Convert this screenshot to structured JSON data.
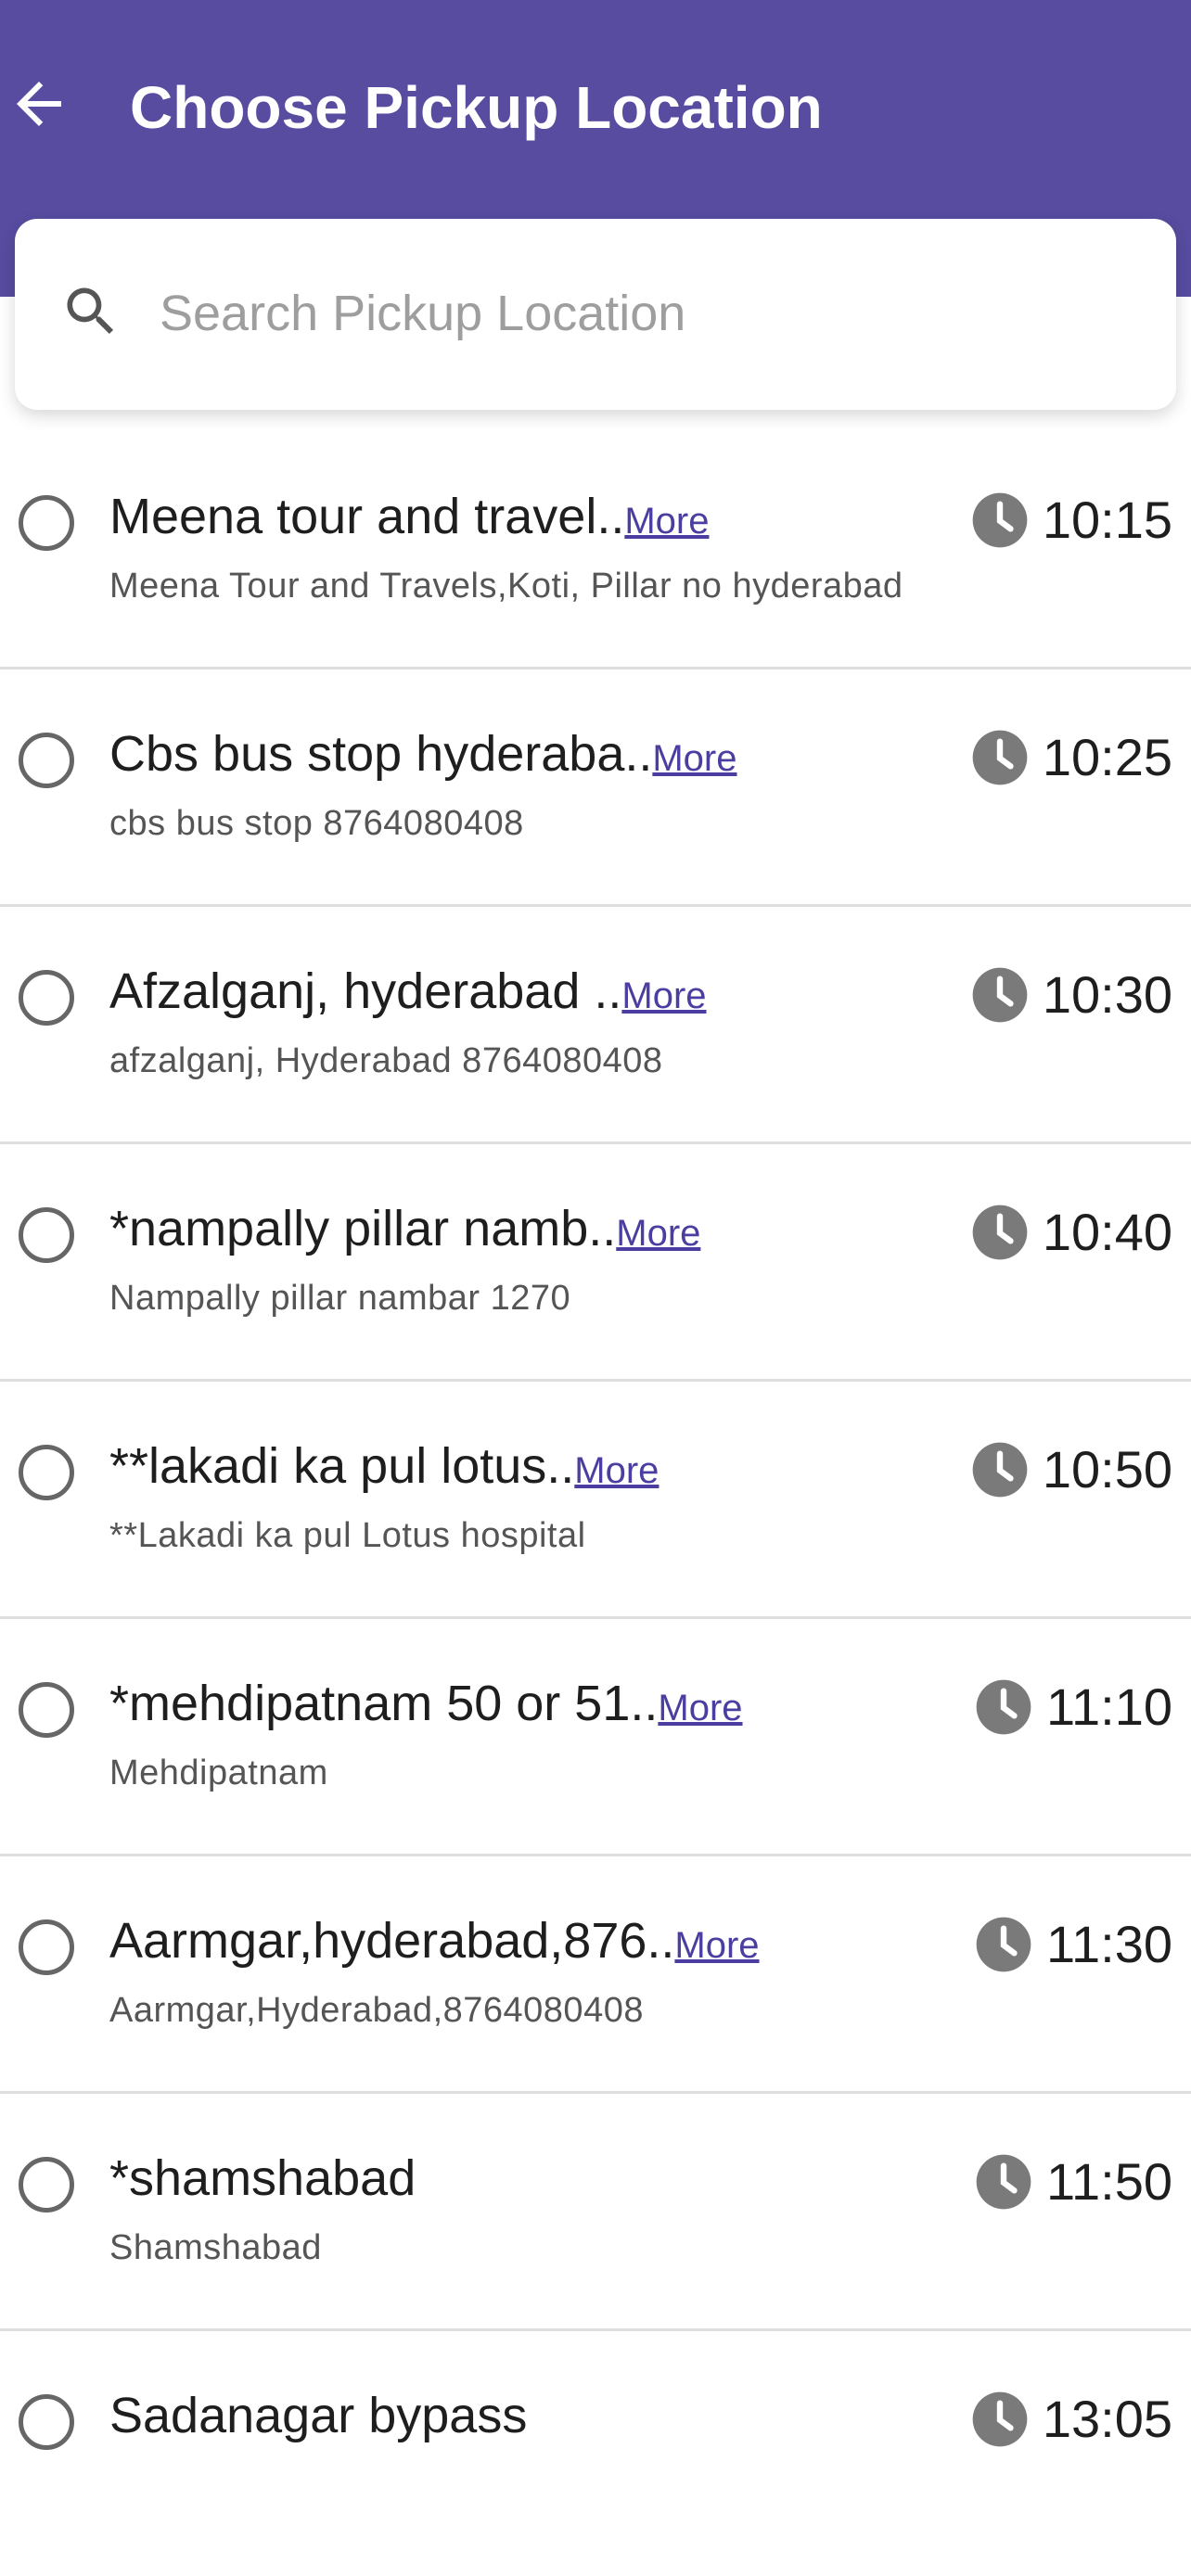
{
  "colors": {
    "header_bg": "#574ca0",
    "more_link": "#4a3fa0",
    "clock_icon": "#7a7a7a"
  },
  "header": {
    "title": "Choose Pickup Location",
    "back_icon": "arrow-left-icon"
  },
  "search": {
    "placeholder": "Search Pickup Location",
    "icon": "search-icon",
    "value": ""
  },
  "locations": [
    {
      "name": "Meena tour and travel..",
      "more": "More",
      "address": "Meena Tour and Travels,Koti, Pillar no hyderabad",
      "time": "10:15",
      "selected": false
    },
    {
      "name": "Cbs bus stop hyderaba..",
      "more": "More",
      "address": "cbs bus stop 8764080408",
      "time": "10:25",
      "selected": false
    },
    {
      "name": "Afzalganj, hyderabad ..",
      "more": "More",
      "address": "afzalganj, Hyderabad 8764080408",
      "time": "10:30",
      "selected": false
    },
    {
      "name": "*nampally pillar namb..",
      "more": "More",
      "address": "Nampally pillar nambar 1270",
      "time": "10:40",
      "selected": false
    },
    {
      "name": "**lakadi ka pul lotus..",
      "more": "More",
      "address": "**Lakadi ka pul Lotus hospital",
      "time": "10:50",
      "selected": false
    },
    {
      "name": "*mehdipatnam 50 or 51..",
      "more": "More",
      "address": "Mehdipatnam",
      "time": "11:10",
      "selected": false
    },
    {
      "name": "Aarmgar,hyderabad,876..",
      "more": "More",
      "address": "Aarmgar,Hyderabad,8764080408",
      "time": "11:30",
      "selected": false
    },
    {
      "name": "*shamshabad",
      "more": "",
      "address": "Shamshabad",
      "time": "11:50",
      "selected": false
    },
    {
      "name": "Sadanagar bypass",
      "more": "",
      "address": "",
      "time": "13:05",
      "selected": false
    }
  ]
}
